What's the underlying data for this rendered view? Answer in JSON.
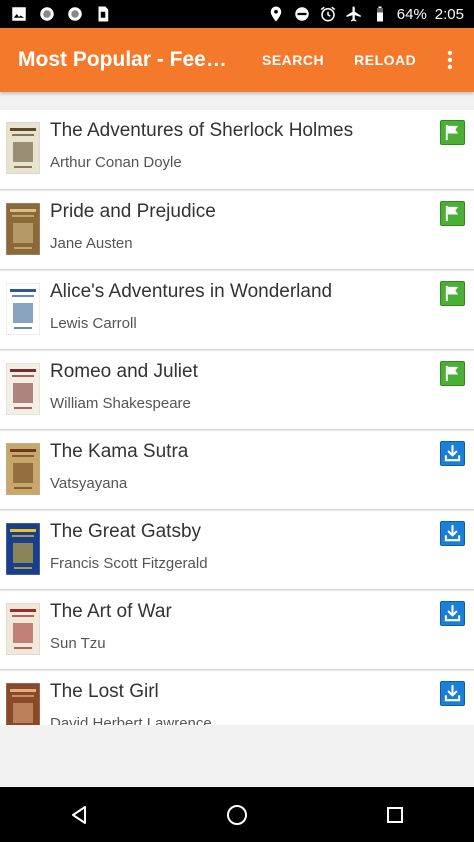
{
  "status_bar": {
    "battery": "64%",
    "time": "2:05",
    "left_icons": [
      "image-icon",
      "circle-icon",
      "circle-icon",
      "sd-card-icon"
    ],
    "right_icons": [
      "location-icon",
      "dnd-icon",
      "alarm-icon",
      "airplane-icon",
      "battery-icon"
    ]
  },
  "app_bar": {
    "title": "Most Popular - Fee…",
    "search_label": "SEARCH",
    "reload_label": "RELOAD",
    "overflow_icon": "more-vert-icon",
    "color": "#f4792a"
  },
  "books": [
    {
      "title": "The Adventures of Sherlock Holmes",
      "author": "Arthur Conan Doyle",
      "action": "flag",
      "cover_color": "#e9e2cf",
      "cover_accent": "#5a4a2a"
    },
    {
      "title": "Pride and Prejudice",
      "author": "Jane Austen",
      "action": "flag",
      "cover_color": "#8b6a3a",
      "cover_accent": "#d8c08a"
    },
    {
      "title": "Alice's Adventures in Wonderland",
      "author": "Lewis Carroll",
      "action": "flag",
      "cover_color": "#ffffff",
      "cover_accent": "#2a5a8a"
    },
    {
      "title": "Romeo and Juliet",
      "author": "William Shakespeare",
      "action": "flag",
      "cover_color": "#f4efe4",
      "cover_accent": "#7a2a2a"
    },
    {
      "title": "The Kama Sutra",
      "author": "Vatsyayana",
      "action": "download",
      "cover_color": "#c8a86a",
      "cover_accent": "#6a3a1a"
    },
    {
      "title": "The Great Gatsby",
      "author": "Francis Scott Fitzgerald",
      "action": "download",
      "cover_color": "#1a3f8a",
      "cover_accent": "#e8c030"
    },
    {
      "title": "The Art of War",
      "author": "Sun Tzu",
      "action": "download",
      "cover_color": "#f0e8d8",
      "cover_accent": "#9a2a2a"
    },
    {
      "title": "The Lost Girl",
      "author": "David Herbert Lawrence",
      "action": "download",
      "cover_color": "#8a4a2a",
      "cover_accent": "#e0b080"
    }
  ],
  "colors": {
    "flag_green": "#4caf35",
    "download_blue": "#1a7fd6"
  },
  "nav_bar": {
    "back_icon": "back-icon",
    "home_icon": "home-icon",
    "recents_icon": "recents-icon"
  }
}
